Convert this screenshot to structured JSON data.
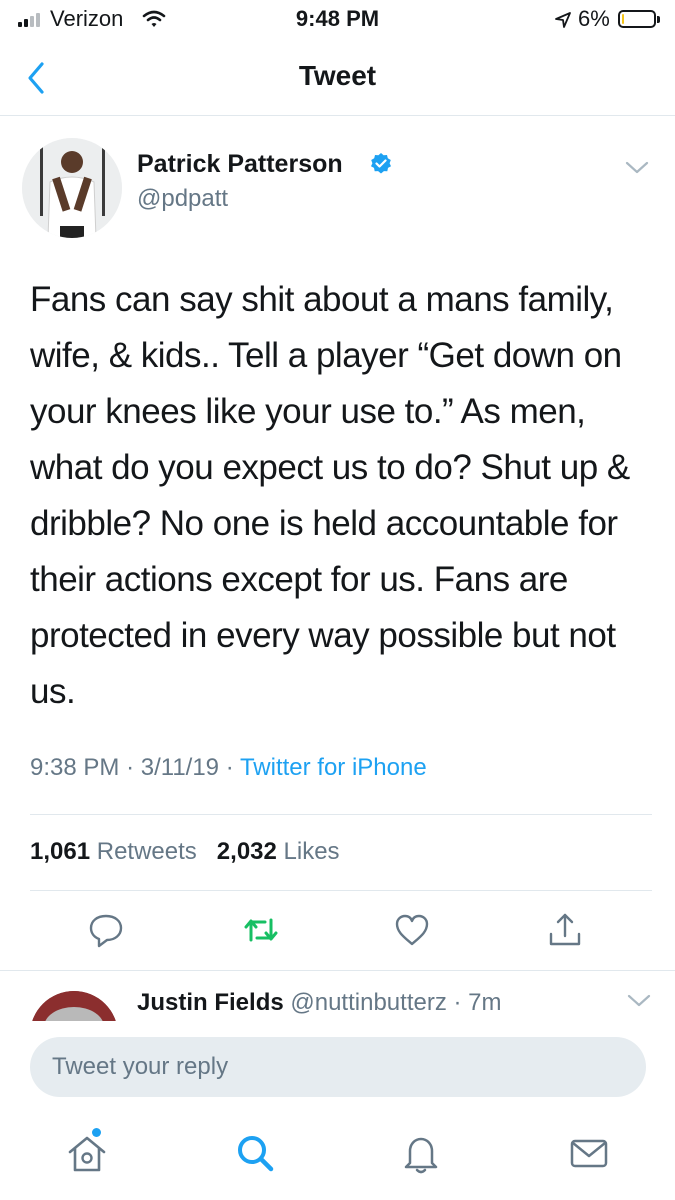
{
  "status_bar": {
    "carrier": "Verizon",
    "time": "9:48 PM",
    "battery_percent": "6%",
    "battery_level": 0.06
  },
  "nav": {
    "title": "Tweet",
    "back_icon": "chevron-left-icon"
  },
  "tweet": {
    "author_name": "Patrick Patterson",
    "handle": "@pdpatt",
    "text": "Fans can say shit about a mans family, wife, & kids.. Tell a player “Get down on your knees like your use to.” As men, what do you expect us to do? Shut up & dribble? No one is held accountable for their actions except for us. Fans are protected in every way possible but not us.",
    "time": "9:38 PM",
    "date": "3/11/19",
    "source": "Twitter for iPhone",
    "retweets_count": "1,061",
    "retweets_label": "Retweets",
    "likes_count": "2,032",
    "likes_label": "Likes"
  },
  "reply_preview": {
    "name": "Justin Fields",
    "handle": "@nuttinbutterz",
    "age": "7m"
  },
  "composer": {
    "placeholder": "Tweet your reply"
  },
  "colors": {
    "accent": "#1da1f2",
    "retweet": "#17bf63",
    "secondary_text": "#657786",
    "battery_low": "#f5c518"
  },
  "tab_bar": [
    "home-icon",
    "search-icon",
    "bell-icon",
    "mail-icon"
  ]
}
